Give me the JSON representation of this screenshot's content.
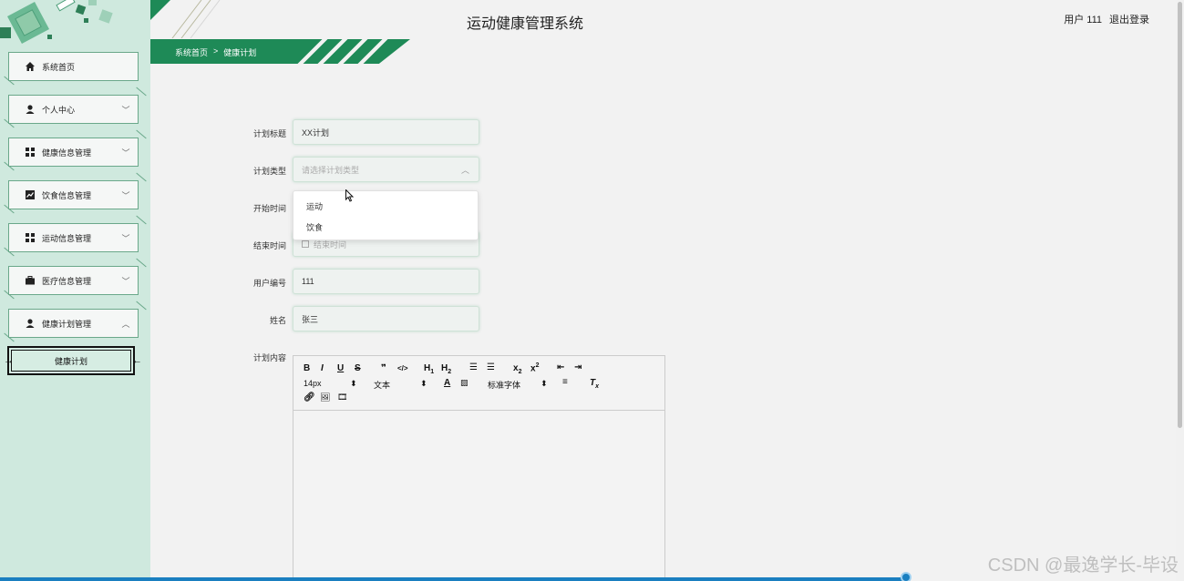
{
  "header": {
    "title": "运动健康管理系统",
    "user_label": "用户 111",
    "logout": "退出登录"
  },
  "breadcrumb": {
    "home": "系统首页",
    "separator": ">",
    "current": "健康计划"
  },
  "sidebar": {
    "items": [
      {
        "label": "系统首页",
        "icon": "home-icon",
        "expandable": false
      },
      {
        "label": "个人中心",
        "icon": "user-icon",
        "expandable": true,
        "chevron": "﹀"
      },
      {
        "label": "健康信息管理",
        "icon": "grid-icon",
        "expandable": true,
        "chevron": "﹀"
      },
      {
        "label": "饮食信息管理",
        "icon": "chart-icon",
        "expandable": true,
        "chevron": "﹀"
      },
      {
        "label": "运动信息管理",
        "icon": "grid-icon",
        "expandable": true,
        "chevron": "﹀"
      },
      {
        "label": "医疗信息管理",
        "icon": "briefcase-icon",
        "expandable": true,
        "chevron": "﹀"
      },
      {
        "label": "健康计划管理",
        "icon": "user-icon",
        "expandable": true,
        "chevron": "︿"
      }
    ],
    "active_subitem": "健康计划"
  },
  "form": {
    "title_label": "计划标题",
    "title_value": "XX计划",
    "type_label": "计划类型",
    "type_placeholder": "请选择计划类型",
    "type_options": [
      "运动",
      "饮食"
    ],
    "start_label": "开始时间",
    "end_label": "结束时间",
    "end_placeholder": "结束时间",
    "userid_label": "用户编号",
    "userid_value": "111",
    "name_label": "姓名",
    "name_value": "张三",
    "content_label": "计划内容"
  },
  "editor": {
    "font_size": "14px",
    "block_type": "文本",
    "font_family": "标准字体",
    "buttons_row1": [
      "B",
      "I",
      "U",
      "S",
      "99",
      "</>",
      "H1",
      "H2",
      "ol",
      "ul",
      "x2",
      "x²",
      "outdent",
      "indent"
    ]
  },
  "watermark": "CSDN @最逸学长-毕设",
  "colors": {
    "accent": "#1e8a57",
    "sidebar_bg": "#cfe9de",
    "page_bg": "#f2f2f2"
  }
}
